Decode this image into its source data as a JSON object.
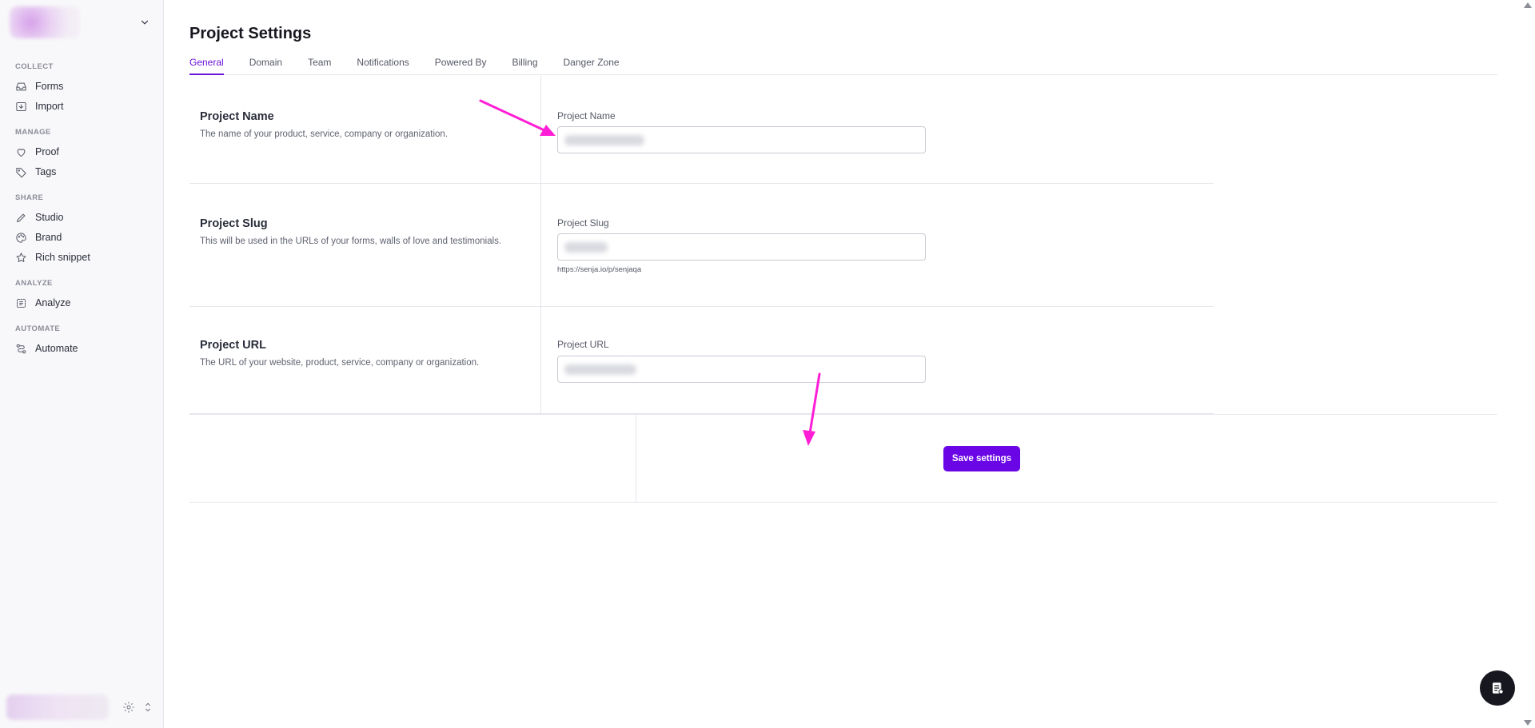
{
  "sidebar": {
    "sections": [
      {
        "title": "COLLECT",
        "items": [
          {
            "label": "Forms",
            "icon": "inbox-icon"
          },
          {
            "label": "Import",
            "icon": "import-icon"
          }
        ]
      },
      {
        "title": "MANAGE",
        "items": [
          {
            "label": "Proof",
            "icon": "heart-icon"
          },
          {
            "label": "Tags",
            "icon": "tag-icon"
          }
        ]
      },
      {
        "title": "SHARE",
        "items": [
          {
            "label": "Studio",
            "icon": "pencil-icon"
          },
          {
            "label": "Brand",
            "icon": "palette-icon"
          },
          {
            "label": "Rich snippet",
            "icon": "star-icon"
          }
        ]
      },
      {
        "title": "ANALYZE",
        "items": [
          {
            "label": "Analyze",
            "icon": "analyze-icon"
          }
        ]
      },
      {
        "title": "AUTOMATE",
        "items": [
          {
            "label": "Automate",
            "icon": "automate-icon"
          }
        ]
      }
    ]
  },
  "page": {
    "title": "Project Settings",
    "tabs": [
      "General",
      "Domain",
      "Team",
      "Notifications",
      "Powered By",
      "Billing",
      "Danger Zone"
    ],
    "active_tab": "General"
  },
  "rows": [
    {
      "heading": "Project Name",
      "description": "The name of your product, service, company or organization.",
      "field_label": "Project Name"
    },
    {
      "heading": "Project Slug",
      "description": "This will be used in the URLs of your forms, walls of love and testimonials.",
      "field_label": "Project Slug",
      "hint": "https://senja.io/p/senjaqa"
    },
    {
      "heading": "Project URL",
      "description": "The URL of your website, product, service, company or organization.",
      "field_label": "Project URL"
    }
  ],
  "actions": {
    "save_label": "Save settings"
  },
  "colors": {
    "accent": "#6a06e6",
    "annotation_arrow": "#ff1ed6"
  }
}
